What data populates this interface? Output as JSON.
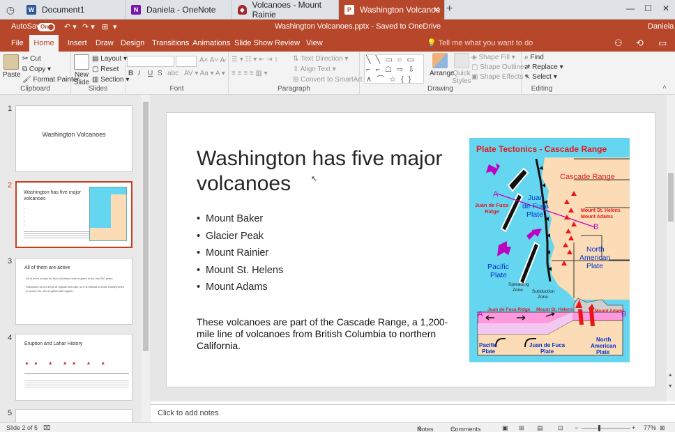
{
  "browser_tabs": [
    {
      "label": "Document1",
      "icon": "W"
    },
    {
      "label": "Daniela - OneNote",
      "icon": "N"
    },
    {
      "label": "Volcanoes - Mount Rainie",
      "icon": "shield"
    },
    {
      "label": "Washington Volcanoe",
      "icon": "P"
    }
  ],
  "titlebar": {
    "autosave_label": "AutoSave",
    "autosave_state": "On",
    "doc_title": "Washington Volcanoes.pptx - Saved to OneDrive",
    "user": "Daniela"
  },
  "ribbon_tabs": [
    "File",
    "Home",
    "Insert",
    "Draw",
    "Design",
    "Transitions",
    "Animations",
    "Slide Show",
    "Review",
    "View"
  ],
  "tell_me": "Tell me what you want to do",
  "ribbon": {
    "clipboard": {
      "paste": "Paste",
      "cut": "Cut",
      "copy": "Copy",
      "format_painter": "Format Painter",
      "label": "Clipboard"
    },
    "slides": {
      "new_slide": "New Slide",
      "layout": "Layout",
      "reset": "Reset",
      "section": "Section",
      "label": "Slides"
    },
    "font": {
      "bold": "B",
      "italic": "I",
      "underline": "U",
      "strike": "S",
      "shadow": "abc",
      "label": "Font"
    },
    "paragraph": {
      "text_direction": "Text Direction",
      "align_text": "Align Text",
      "smartart": "Convert to SmartArt",
      "label": "Paragraph"
    },
    "drawing": {
      "arrange": "Arrange",
      "quick_styles": "Quick Styles",
      "shape_fill": "Shape Fill",
      "shape_outline": "Shape Outline",
      "shape_effects": "Shape Effects",
      "label": "Drawing"
    },
    "editing": {
      "find": "Find",
      "replace": "Replace",
      "select": "Select",
      "label": "Editing"
    }
  },
  "thumbnails": [
    {
      "num": "1",
      "title": "Washington Volcanoes"
    },
    {
      "num": "2",
      "title": "Washington has five major volcanoes"
    },
    {
      "num": "3",
      "title": "All of them are active",
      "lines": [
        "All of them except for Mount Adams have erupted in the last 250 years.",
        "Volcanoes do not erupt at regular intervals, so it is difficult to know exactly when or where the next eruption will happen."
      ]
    },
    {
      "num": "4",
      "title": "Eruption and Lahar History"
    },
    {
      "num": "5",
      "title": ""
    }
  ],
  "slide": {
    "title": "Washington has five major volcanoes",
    "bullets": [
      "Mount Baker",
      "Glacier Peak",
      "Mount Rainier",
      "Mount St. Helens",
      "Mount Adams"
    ],
    "paragraph": "These volcanoes are part of the Cascade Range, a 1,200-mile line of volcanoes from British Columbia to northern California."
  },
  "map": {
    "title": "Plate Tectonics - Cascade Range",
    "cascade_range": "Cascade Range",
    "jdf_ridge": "Juan de Fuca Ridge",
    "jdf_plate": "Juan de Fuca Plate",
    "pacific_plate": "Pacific Plate",
    "na_plate": "North American Plate",
    "st_helens": "Mount St. Helens",
    "adams": "Mount Adams",
    "spreading": "Spreading Zone",
    "subduction": "Subduction Zone",
    "a": "A",
    "b": "B",
    "xs_ridge": "Juan de Fuca Ridge",
    "xs_helens": "Mount St. Helens",
    "xs_adams": "Mount Adams",
    "xs_pacific": "Pacific Plate",
    "xs_jdf": "Juan de Fuca Plate",
    "xs_na": "North American Plate"
  },
  "notes_placeholder": "Click to add notes",
  "status": {
    "slide_info": "Slide 2 of 5",
    "notes": "Notes",
    "comments": "Comments",
    "zoom": "77%"
  },
  "colors": {
    "accent": "#b7472a",
    "map_water": "#64d6ef",
    "map_land": "#fbdcb6",
    "map_red": "#e8161b",
    "map_magenta": "#c000c0"
  }
}
